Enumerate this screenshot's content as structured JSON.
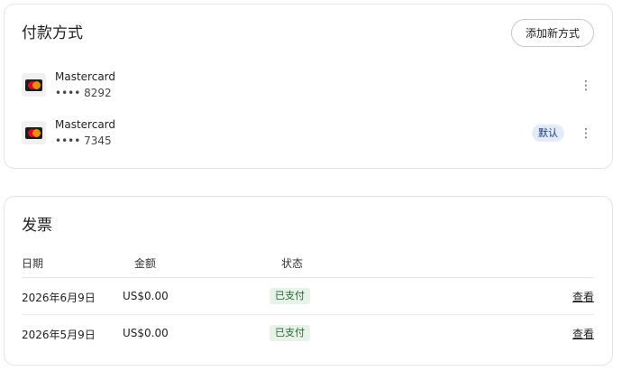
{
  "payment": {
    "title": "付款方式",
    "add_button": "添加新方式",
    "methods": [
      {
        "brand": "Mastercard",
        "digits": "•••• 8292",
        "is_default": false,
        "icon": "mastercard-icon"
      },
      {
        "brand": "Mastercard",
        "digits": "•••• 7345",
        "is_default": true,
        "icon": "mastercard-icon"
      }
    ],
    "default_badge": "默认",
    "more_icon": "⋮"
  },
  "invoices": {
    "title": "发票",
    "headers": {
      "date": "日期",
      "amount": "金额",
      "status": "状态"
    },
    "rows": [
      {
        "date": "2026年6月9日",
        "amount": "US$0.00",
        "status": "已支付",
        "action": "查看"
      },
      {
        "date": "2026年5月9日",
        "amount": "US$0.00",
        "status": "已支付",
        "action": "查看"
      }
    ]
  },
  "colors": {
    "default_badge_bg": "#e3ebfb",
    "paid_badge_bg": "#e7f3e8",
    "paid_badge_text": "#1e6b2a"
  }
}
